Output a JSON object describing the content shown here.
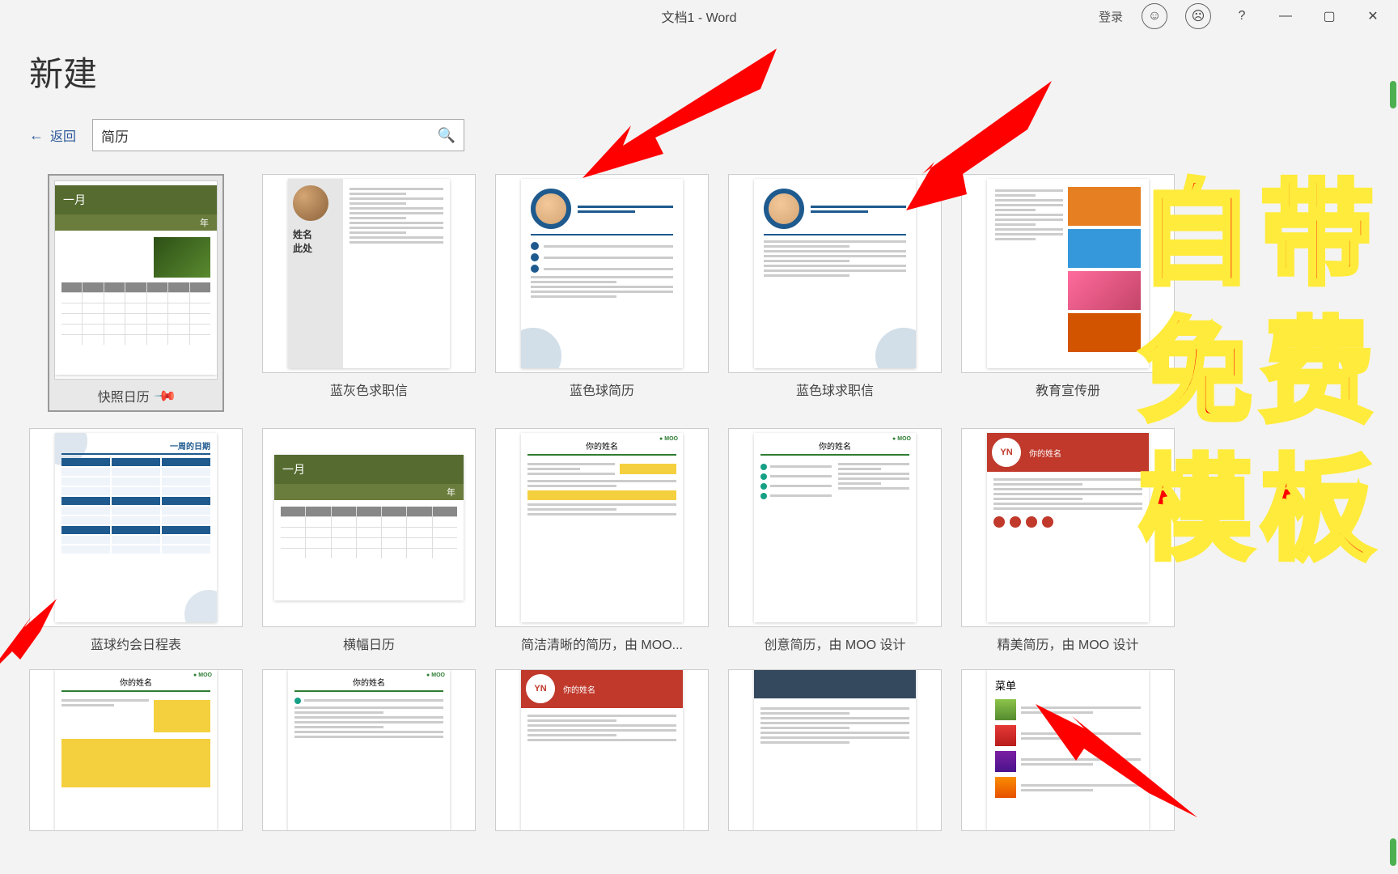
{
  "titlebar": {
    "title": "文档1 - Word",
    "login": "登录"
  },
  "page": {
    "title": "新建",
    "back": "返回"
  },
  "search": {
    "value": "简历"
  },
  "templates": [
    {
      "label": "快照日历",
      "selected": true,
      "kind": "cal-olive"
    },
    {
      "label": "蓝灰色求职信",
      "kind": "resume-gray"
    },
    {
      "label": "蓝色球简历",
      "kind": "blue-ball"
    },
    {
      "label": "蓝色球求职信",
      "kind": "blue-ball-2"
    },
    {
      "label": "教育宣传册",
      "kind": "edu"
    },
    {
      "label": "蓝球约会日程表",
      "kind": "blue-sched"
    },
    {
      "label": "横幅日历",
      "kind": "wide-cal"
    },
    {
      "label": "简洁清晰的简历，由 MOO...",
      "kind": "moo-yellow"
    },
    {
      "label": "创意简历，由 MOO 设计",
      "kind": "moo-teal"
    },
    {
      "label": "精美简历，由 MOO 设计",
      "kind": "moo-red"
    },
    {
      "label": "",
      "kind": "moo-yellow-2"
    },
    {
      "label": "",
      "kind": "moo-teal-2"
    },
    {
      "label": "",
      "kind": "moo-red-2"
    },
    {
      "label": "",
      "kind": "slate"
    },
    {
      "label": "",
      "kind": "menu"
    }
  ],
  "thumb_text": {
    "month": "一月",
    "year": "年",
    "name1": "姓名",
    "name2": "此处",
    "moo": "MOO",
    "yn": "YN",
    "your_name": "你的姓名",
    "week": "一周的日期",
    "menu": "菜单"
  },
  "annotations": {
    "big1": "自",
    "big2": "带",
    "big3": "免",
    "big4": "费",
    "big5": "模",
    "big6": "板"
  }
}
